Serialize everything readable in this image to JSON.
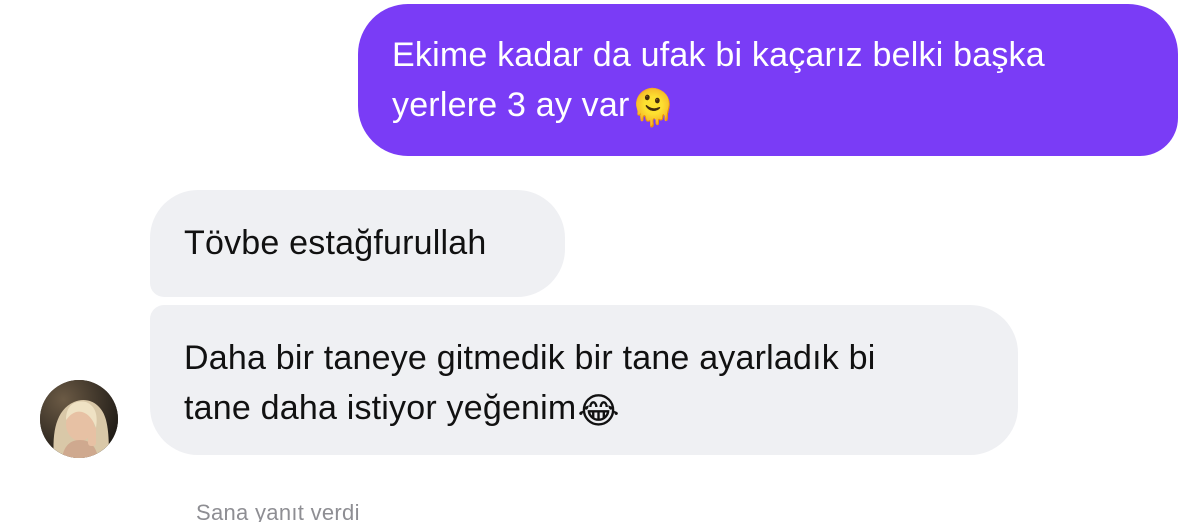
{
  "messages": [
    {
      "direction": "outgoing",
      "line1": "Ekime kadar da ufak bi kaçarız belki başka",
      "line2": "yerlere 3 ay var",
      "emoji": "🫠",
      "emoji_name": "melting-face-emoji"
    },
    {
      "direction": "incoming",
      "text": "Tövbe estağfurullah"
    },
    {
      "direction": "incoming",
      "line1": "Daha bir taneye gitmedik bir tane ayarladık bi",
      "line2": "tane daha istiyor yeğenim",
      "emoji": "😂",
      "emoji_name": "tears-of-joy-emoji"
    }
  ],
  "status_text": "Sana yanıt verdi",
  "colors": {
    "outgoing_bubble": "#7a3cf6",
    "incoming_bubble": "#eff0f3",
    "status_text": "#8e8e93"
  }
}
